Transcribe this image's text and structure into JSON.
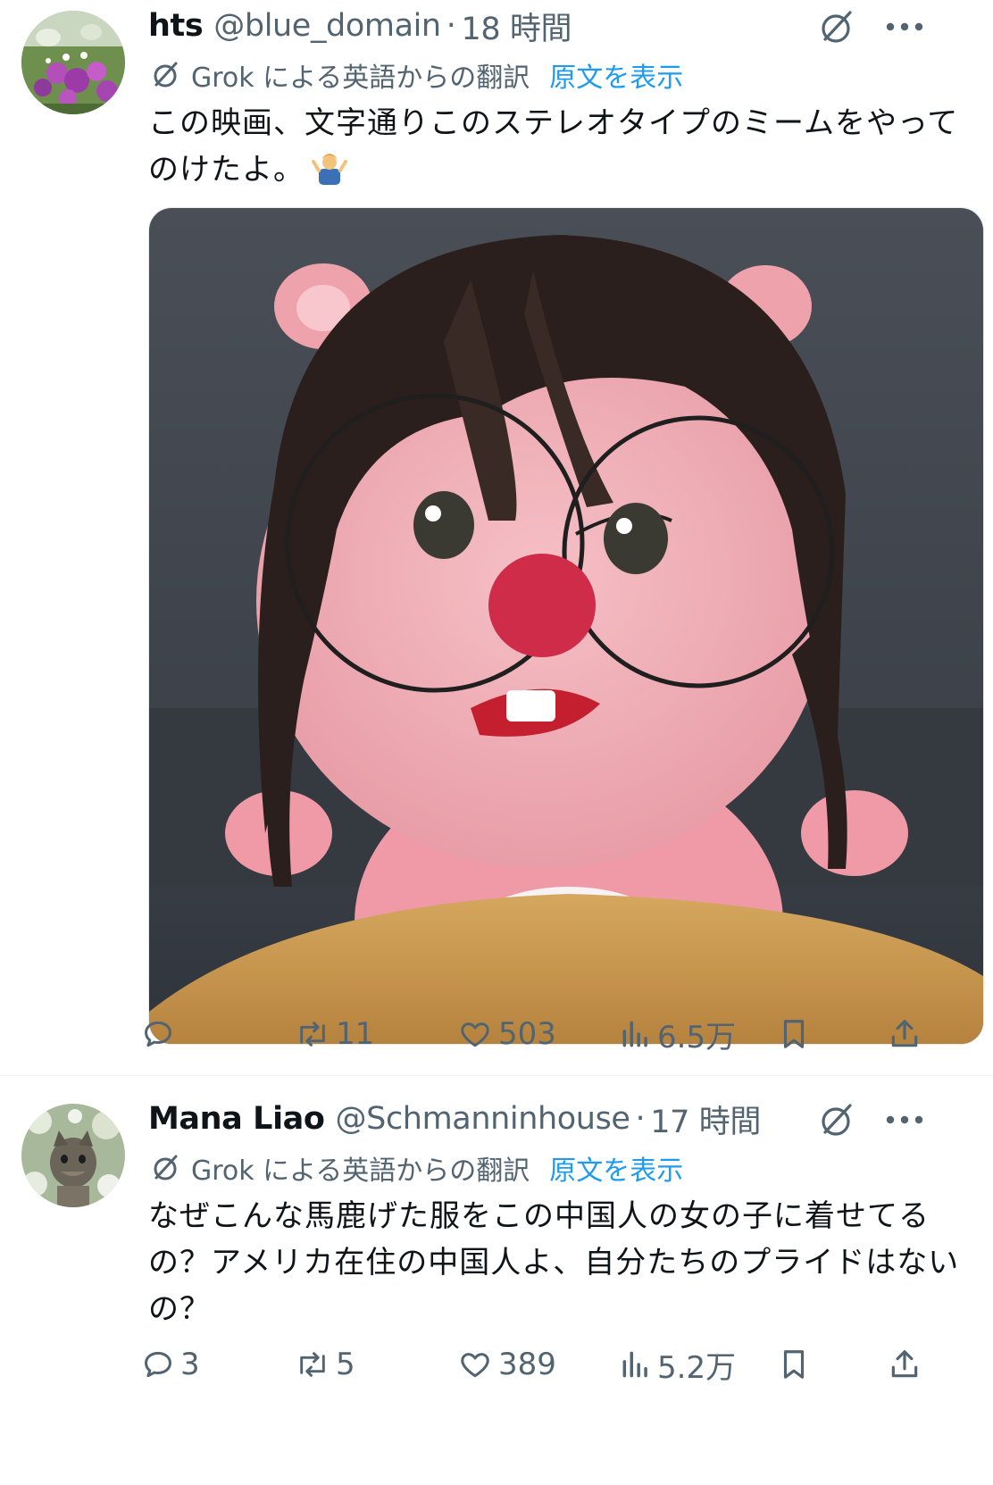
{
  "posts": [
    {
      "author": {
        "name": "hts",
        "handle": "@blue_domain",
        "separator": "·",
        "time": "18 時間"
      },
      "translation": {
        "label": "Grok による英語からの翻訳",
        "show_original": "原文を表示"
      },
      "text": "この映画、文字通りこのステレオタイプのミームをやってのけたよ。",
      "emoji": "person-shrugging",
      "actions": {
        "reply": "",
        "repost": "11",
        "like": "503",
        "views": "6.5万"
      }
    },
    {
      "author": {
        "name": "Mana Liao",
        "handle": "@Schmanninhouse",
        "separator": "·",
        "time": "17 時間"
      },
      "translation": {
        "label": "Grok による英語からの翻訳",
        "show_original": "原文を表示"
      },
      "text": "なぜこんな馬鹿げた服をこの中国人の女の子に着せてるの？アメリカ在住の中国人よ、自分たちのプライドはないの？",
      "actions": {
        "reply": "3",
        "repost": "5",
        "like": "389",
        "views": "5.2万"
      }
    }
  ],
  "colors": {
    "text": "#0f1419",
    "secondary": "#536471",
    "link": "#1d9bf0"
  },
  "icons": [
    "grok-icon",
    "more-icon",
    "reply-icon",
    "repost-icon",
    "like-icon",
    "views-icon",
    "bookmark-icon",
    "share-icon"
  ]
}
